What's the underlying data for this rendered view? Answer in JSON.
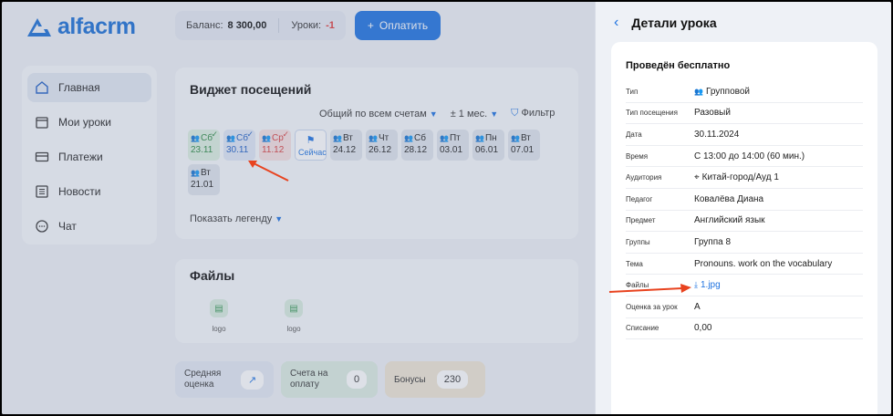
{
  "logo": {
    "text": "alfacrm"
  },
  "topbar": {
    "balance_label": "Баланс:",
    "balance_value": "8 300,00",
    "lessons_label": "Уроки:",
    "lessons_value": "-1",
    "pay_label": "Оплатить"
  },
  "sidebar": {
    "items": [
      {
        "label": "Главная",
        "icon": "home-icon"
      },
      {
        "label": "Мои уроки",
        "icon": "calendar-icon"
      },
      {
        "label": "Платежи",
        "icon": "card-icon"
      },
      {
        "label": "Новости",
        "icon": "news-icon"
      },
      {
        "label": "Чат",
        "icon": "chat-icon"
      }
    ]
  },
  "widget": {
    "title": "Виджет посещений",
    "filter_accounts": "Общий по всем счетам",
    "filter_period": "± 1 мес.",
    "filter_label": "Фильтр",
    "legend_label": "Показать легенду",
    "days": [
      {
        "wd": "Сб",
        "date": "23.11",
        "state": "g"
      },
      {
        "wd": "Сб",
        "date": "30.11",
        "state": "b"
      },
      {
        "wd": "Ср",
        "date": "11.12",
        "state": "r"
      },
      {
        "wd": "Сейчас",
        "date": "",
        "state": "now"
      },
      {
        "wd": "Вт",
        "date": "24.12",
        "state": ""
      },
      {
        "wd": "Чт",
        "date": "26.12",
        "state": ""
      },
      {
        "wd": "Сб",
        "date": "28.12",
        "state": ""
      },
      {
        "wd": "Пт",
        "date": "03.01",
        "state": ""
      },
      {
        "wd": "Пн",
        "date": "06.01",
        "state": ""
      },
      {
        "wd": "Вт",
        "date": "07.01",
        "state": ""
      },
      {
        "wd": "Вт",
        "date": "21.01",
        "state": ""
      }
    ]
  },
  "files": {
    "title": "Файлы",
    "items": [
      {
        "label": "logo"
      },
      {
        "label": "logo"
      }
    ]
  },
  "stats": [
    {
      "label": "Средняя оценка",
      "value": "↗"
    },
    {
      "label": "Счета на оплату",
      "value": "0"
    },
    {
      "label": "Бонусы",
      "value": "230"
    }
  ],
  "panel": {
    "title": "Детали урока",
    "status": "Проведён бесплатно",
    "rows": [
      {
        "k": "Тип",
        "v": "Групповой"
      },
      {
        "k": "Тип посещения",
        "v": "Разовый"
      },
      {
        "k": "Дата",
        "v": "30.11.2024"
      },
      {
        "k": "Время",
        "v": "С 13:00 до 14:00 (60 мин.)"
      },
      {
        "k": "Аудитория",
        "v": "Китай-город/Ауд 1"
      },
      {
        "k": "Педагог",
        "v": "Ковалёва Диана"
      },
      {
        "k": "Предмет",
        "v": "Английский язык"
      },
      {
        "k": "Группы",
        "v": "Группа 8"
      },
      {
        "k": "Тема",
        "v": "Pronouns. work on the vocabulary"
      },
      {
        "k": "Файлы",
        "v": "1.jpg"
      },
      {
        "k": "Оценка за урок",
        "v": "A"
      },
      {
        "k": "Списание",
        "v": "0,00"
      }
    ]
  },
  "colors": {
    "accent": "#1f73e0",
    "annotation": "#e8431f"
  }
}
